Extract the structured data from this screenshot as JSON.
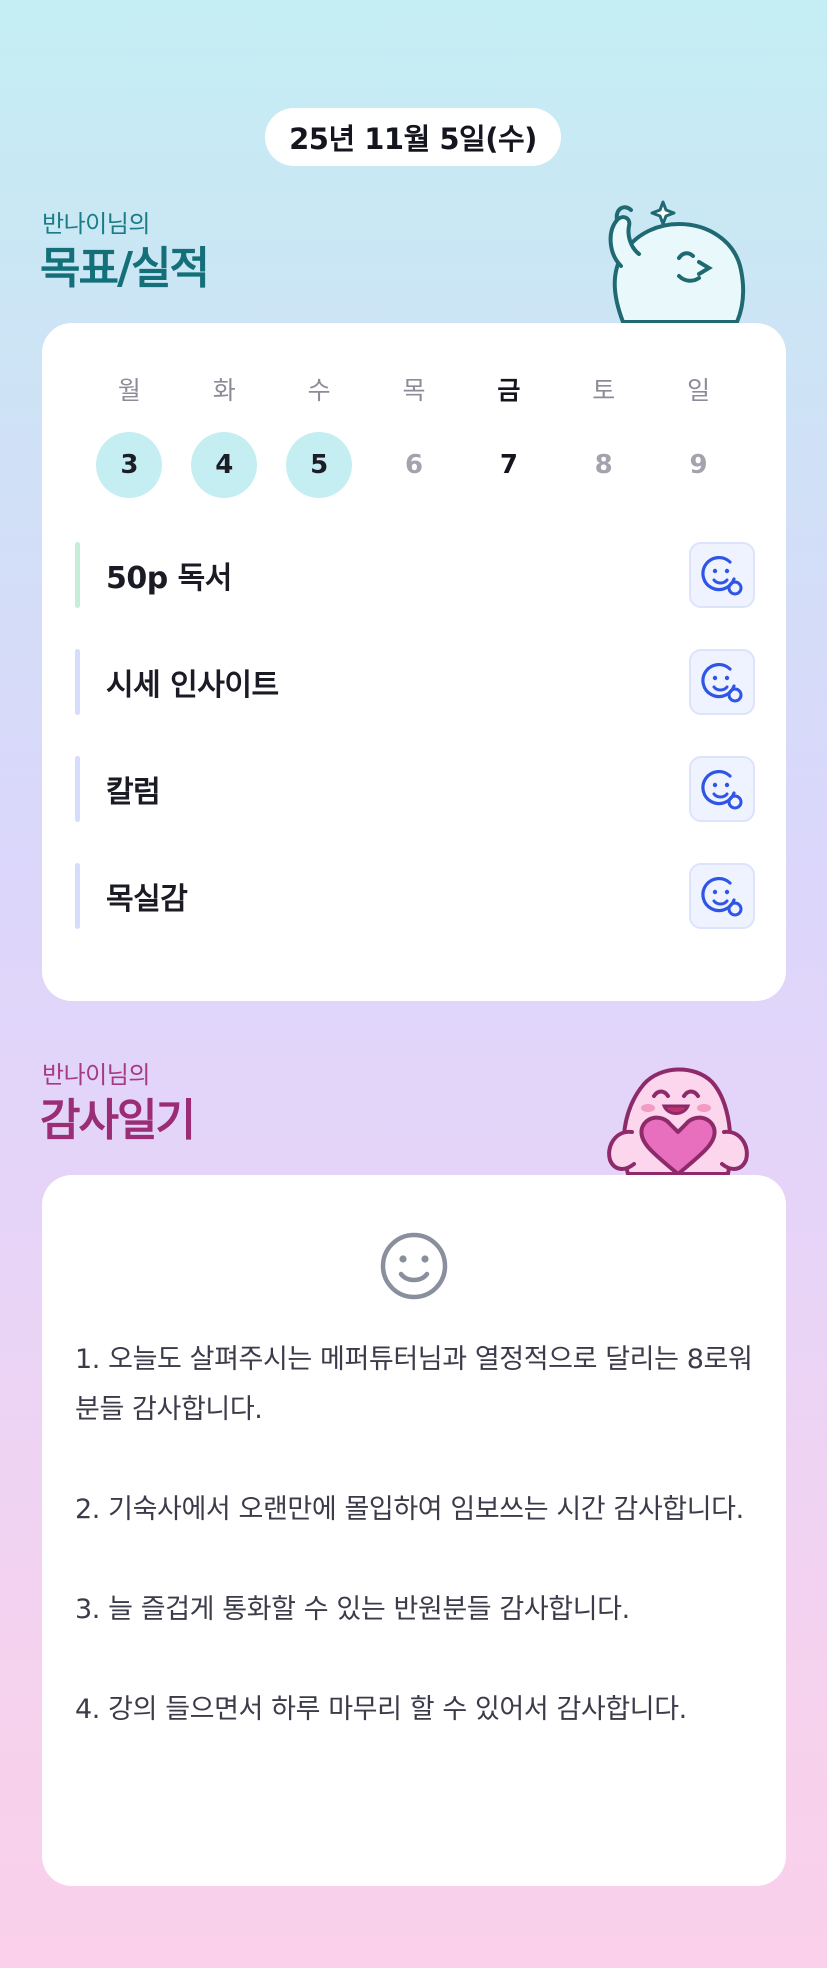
{
  "header": {
    "date": "25년 11월 5일(수)"
  },
  "goals_section": {
    "subtitle": "반나이님의",
    "title": "목표/실적",
    "week": {
      "days": [
        "월",
        "화",
        "수",
        "목",
        "금",
        "토",
        "일"
      ],
      "dates": [
        "3",
        "4",
        "5",
        "6",
        "7",
        "8",
        "9"
      ]
    },
    "items": [
      {
        "label": "50p 독서"
      },
      {
        "label": "시세 인사이트"
      },
      {
        "label": "칼럼"
      },
      {
        "label": "목실감"
      }
    ],
    "icons": {
      "reaction": "smile-add-icon",
      "mascot": "white-mascot-icon"
    }
  },
  "thanks_section": {
    "subtitle": "반나이님의",
    "title": "감사일기",
    "entries": [
      "1. 오늘도 살펴주시는 메퍼튜터님과 열정적으로 달리는 8로워분들 감사합니다.",
      "2. 기숙사에서 오랜만에 몰입하여 임보쓰는 시간 감사합니다.",
      "3. 늘 즐겁게 통화할 수 있는 반원분들 감사합니다.",
      "4. 강의 들으면서 하루 마무리 할 수 있어서 감사합니다."
    ],
    "icons": {
      "mood": "smile-icon",
      "mascot": "pink-mascot-heart-icon"
    }
  },
  "colors": {
    "goal_title": "#137078",
    "thanks_title": "#9a2d76",
    "done_date": "#c4eef1",
    "reaction_icon": "#2f55e6"
  }
}
